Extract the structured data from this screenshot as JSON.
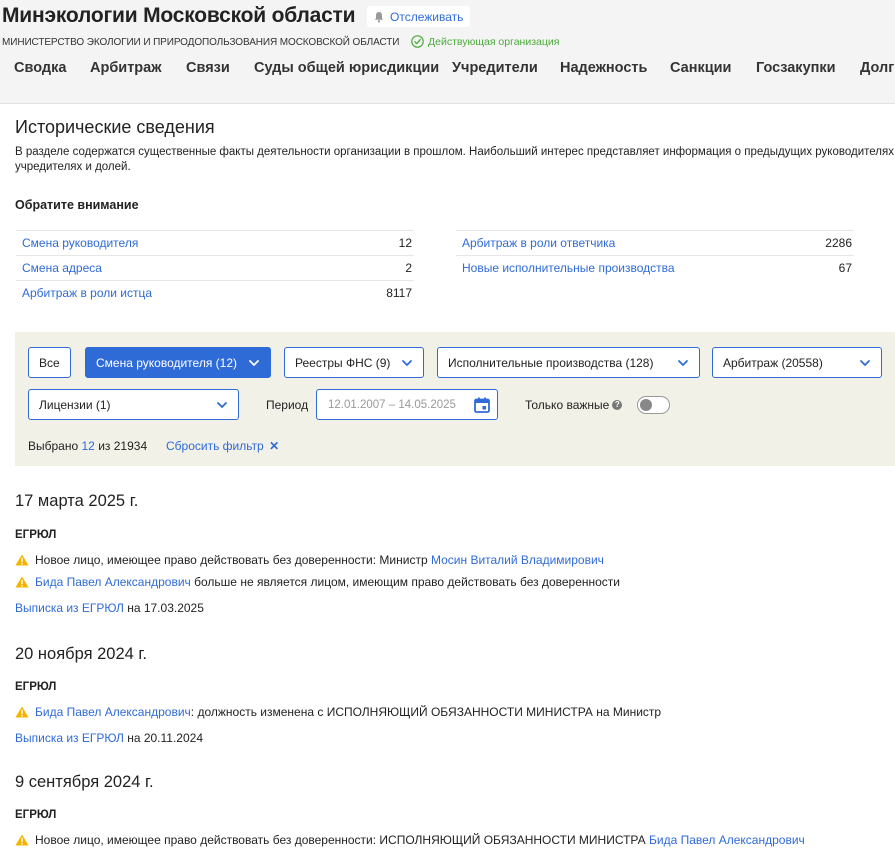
{
  "header": {
    "title": "Минэкологии Московской области",
    "track_label": "Отслеживать",
    "full_name": "МИНИСТЕРСТВО ЭКОЛОГИИ И ПРИРОДОПОЛЬЗОВАНИЯ МОСКОВСКОЙ ОБЛАСТИ",
    "status": "Действующая организация",
    "nav": [
      "Сводка",
      "Арбитраж",
      "Связи",
      "Суды общей юрисдикции",
      "Учредители",
      "Надежность",
      "Санкции",
      "Госзакупки",
      "Долги"
    ]
  },
  "section": {
    "title": "Исторические сведения",
    "description": "В разделе содержатся существенные факты деятельности организации в прошлом. Наибольший интерес представляет информация о предыдущих руководителях, учредителях и долей.",
    "attention_title": "Обратите внимание"
  },
  "stats_left": [
    {
      "label": "Смена руководителя",
      "value": "12"
    },
    {
      "label": "Смена адреса",
      "value": "2"
    },
    {
      "label": "Арбитраж в роли истца",
      "value": "8117"
    }
  ],
  "stats_right": [
    {
      "label": "Арбитраж в роли ответчика",
      "value": "2286"
    },
    {
      "label": "Новые исполнительные производства",
      "value": "67"
    }
  ],
  "filters": {
    "all": "Все",
    "manager_change": "Смена руководителя (12)",
    "fns": "Реестры ФНС (9)",
    "enforcement": "Исполнительные производства (128)",
    "arbitration": "Арбитраж (20558)",
    "licenses": "Лицензии (1)",
    "period_label": "Период",
    "period_placeholder": "12.01.2007 – 14.05.2025",
    "only_important": "Только важные",
    "selected_prefix": "Выбрано",
    "selected_count": "12",
    "selected_of": "из 21934",
    "reset": "Сбросить фильтр"
  },
  "events": [
    {
      "date": "17 марта 2025 г.",
      "source": "ЕГРЮЛ",
      "line1_text": "Новое лицо, имеющее право действовать без доверенности: Министр",
      "line1_link": "Мосин Виталий Владимирович",
      "line2_link": "Бида Павел Александрович",
      "line2_text": "больше не является лицом, имеющим право действовать без доверенности",
      "doc_link": "Выписка из ЕГРЮЛ",
      "doc_date": "на 17.03.2025"
    },
    {
      "date": "20 ноября 2024 г.",
      "source": "ЕГРЮЛ",
      "line1_link": "Бида Павел Александрович",
      "line1_text": ": должность изменена с ИСПОЛНЯЮЩИЙ ОБЯЗАННОСТИ МИНИСТРА на Министр",
      "doc_link": "Выписка из ЕГРЮЛ",
      "doc_date": "на 20.11.2024"
    },
    {
      "date": "9 сентября 2024 г.",
      "source": "ЕГРЮЛ",
      "line1_text": "Новое лицо, имеющее право действовать без доверенности: ИСПОЛНЯЮЩИЙ ОБЯЗАННОСТИ МИНИСТРА",
      "line1_link": "Бида Павел Александрович"
    }
  ],
  "colors": {
    "link": "#2f6bd6",
    "active_filter": "#2f6bd6",
    "status_green": "#4caa3c",
    "warning": "#f2b400",
    "filter_panel_bg": "#f2f1e8"
  }
}
